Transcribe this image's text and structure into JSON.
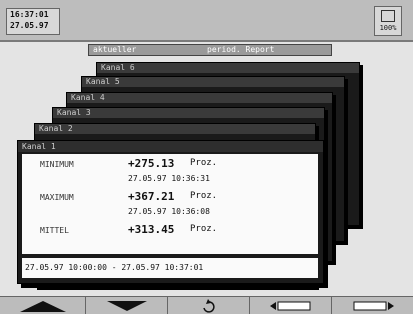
{
  "status": {
    "time": "16:37:01",
    "date": "27.05.97",
    "memory": "100%"
  },
  "header": {
    "mode": "aktueller",
    "report_type": "period. Report"
  },
  "cards": [
    {
      "label": "Kanal 6"
    },
    {
      "label": "Kanal 5"
    },
    {
      "label": "Kanal 4"
    },
    {
      "label": "Kanal 3"
    },
    {
      "label": "Kanal 2"
    },
    {
      "label": "Kanal 1"
    }
  ],
  "report": {
    "minimum": {
      "label": "MINIMUM",
      "value": "+275.13",
      "unit": "Proz.",
      "timestamp": "27.05.97 10:36:31"
    },
    "maximum": {
      "label": "MAXIMUM",
      "value": "+367.21",
      "unit": "Proz.",
      "timestamp": "27.05.97 10:36:08"
    },
    "mittel": {
      "label": "MITTEL",
      "value": "+313.45",
      "unit": "Proz."
    },
    "range": "27.05.97 10:00:00 - 27.05.97 10:37:01"
  },
  "softkeys": [
    {
      "icon": "up-arrow-icon"
    },
    {
      "icon": "down-arrow-icon"
    },
    {
      "icon": "undo-icon"
    },
    {
      "icon": "page-left-icon"
    },
    {
      "icon": "page-right-icon"
    }
  ]
}
